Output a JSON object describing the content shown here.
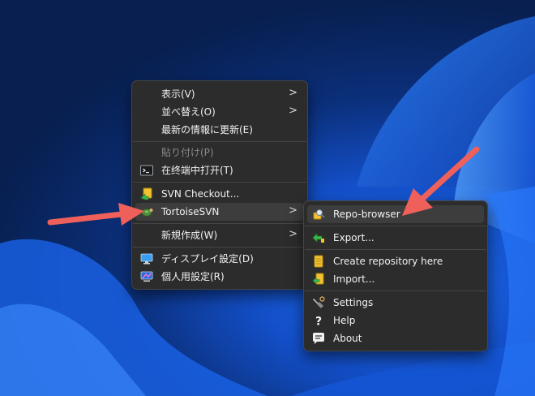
{
  "main_menu": {
    "items": [
      {
        "label": "表示(V)",
        "has_submenu": true
      },
      {
        "label": "並べ替え(O)",
        "has_submenu": true
      },
      {
        "label": "最新の情報に更新(E)"
      },
      {
        "label": "貼り付け(P)",
        "disabled": true
      },
      {
        "label": "在终端中打开(T)",
        "icon": "terminal-icon"
      },
      {
        "label": "SVN Checkout...",
        "icon": "svn-checkout-icon"
      },
      {
        "label": "TortoiseSVN",
        "icon": "tortoisesvn-icon",
        "has_submenu": true,
        "highlighted": true
      },
      {
        "label": "新規作成(W)",
        "has_submenu": true
      },
      {
        "label": "ディスプレイ設定(D)",
        "icon": "display-icon"
      },
      {
        "label": "個人用設定(R)",
        "icon": "personalize-icon"
      }
    ],
    "submenu_arrow": ">"
  },
  "svn_submenu": {
    "items": [
      {
        "label": "Repo-browser",
        "icon": "repo-browser-icon",
        "highlighted": true
      },
      {
        "label": "Export...",
        "icon": "export-icon"
      },
      {
        "label": "Create repository here",
        "icon": "create-repository-icon"
      },
      {
        "label": "Import...",
        "icon": "import-icon"
      },
      {
        "label": "Settings",
        "icon": "settings-icon"
      },
      {
        "label": "Help",
        "icon": "help-icon"
      },
      {
        "label": "About",
        "icon": "about-icon"
      }
    ]
  },
  "colors": {
    "menu_bg": "#2c2c2c",
    "menu_hover": "#3d3d3d",
    "annotation_arrow": "#f0605a",
    "wallpaper_accent": "#1f6cf0"
  }
}
